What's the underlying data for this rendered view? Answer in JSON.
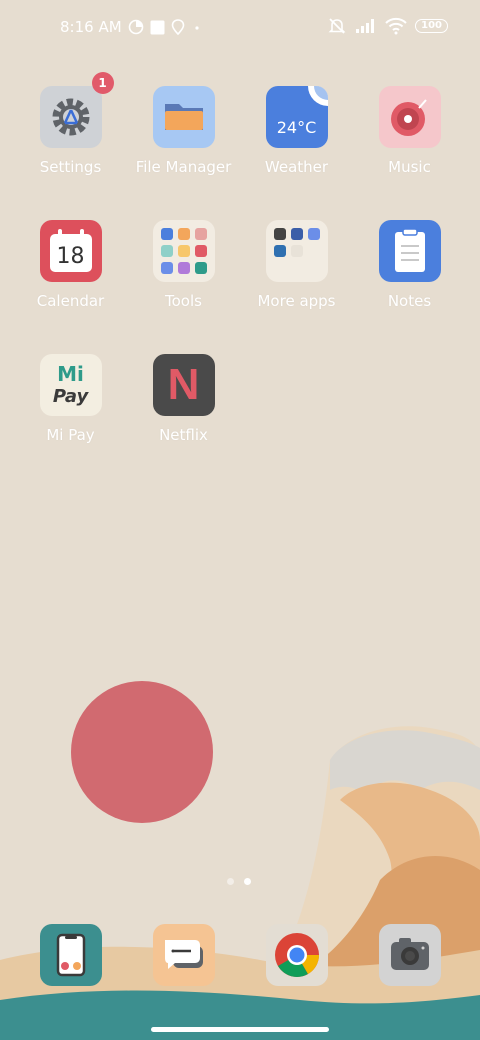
{
  "status_bar": {
    "time": "8:16 AM",
    "battery": "100",
    "icons": [
      "data-saver-icon",
      "square-notification-icon",
      "location-icon",
      "dot-icon",
      "mute-icon",
      "signal-icon",
      "wifi-icon",
      "battery-icon"
    ]
  },
  "apps": [
    {
      "label": "Settings",
      "icon": "gear-icon",
      "badge": "1"
    },
    {
      "label": "File Manager",
      "icon": "folder-icon"
    },
    {
      "label": "Weather",
      "icon": "weather-icon",
      "temperature": "24°C"
    },
    {
      "label": "Music",
      "icon": "music-record-icon"
    },
    {
      "label": "Calendar",
      "icon": "calendar-icon",
      "day": "18"
    },
    {
      "label": "Tools",
      "icon": "tools-folder-icon"
    },
    {
      "label": "More apps",
      "icon": "more-apps-folder-icon"
    },
    {
      "label": "Notes",
      "icon": "notes-icon"
    },
    {
      "label": "Mi Pay",
      "icon": "mi-pay-icon",
      "logo_top": "Mi",
      "logo_bottom": "Pay"
    },
    {
      "label": "Netflix",
      "icon": "netflix-icon",
      "logo": "N"
    }
  ],
  "dock": [
    {
      "name": "phone-dialer",
      "icon": "phone-icon"
    },
    {
      "name": "messages",
      "icon": "message-icon"
    },
    {
      "name": "chrome",
      "icon": "chrome-icon"
    },
    {
      "name": "camera",
      "icon": "camera-icon"
    }
  ],
  "pager": {
    "pages": 2,
    "current": 2
  },
  "colors": {
    "background": "#e6ddd0",
    "sun": "#d16a70",
    "wave_teal": "#3c8f8f",
    "badge": "#e15a6a"
  }
}
